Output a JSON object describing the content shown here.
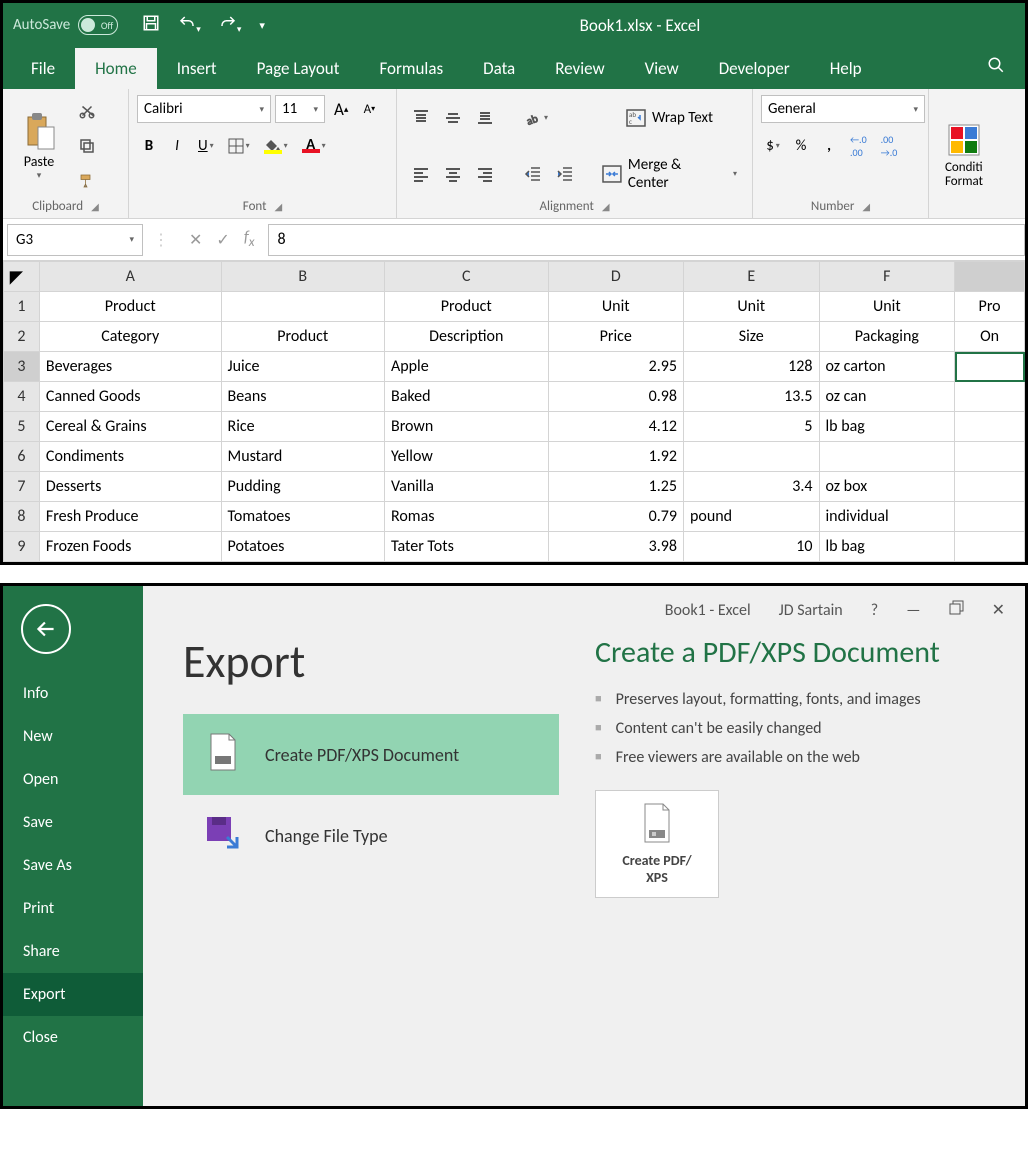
{
  "shot1": {
    "title": "Book1.xlsx  -  Excel",
    "autosave": "AutoSave",
    "autosave_state": "Off",
    "tabs": [
      "File",
      "Home",
      "Insert",
      "Page Layout",
      "Formulas",
      "Data",
      "Review",
      "View",
      "Developer",
      "Help"
    ],
    "active_tab": "Home",
    "ribbon": {
      "clipboard": {
        "label": "Clipboard",
        "paste": "Paste"
      },
      "font": {
        "label": "Font",
        "name": "Calibri",
        "size": "11"
      },
      "alignment": {
        "label": "Alignment",
        "wrap": "Wrap Text",
        "merge": "Merge & Center"
      },
      "number": {
        "label": "Number",
        "format": "General"
      },
      "cond": "Conditional Formatting"
    },
    "namebox": "G3",
    "formula": "8",
    "columns": [
      "A",
      "B",
      "C",
      "D",
      "E",
      "F",
      ""
    ],
    "header_rows": [
      [
        "Product",
        "",
        "Product",
        "Unit",
        "Unit",
        "Unit",
        "Pro"
      ],
      [
        "Category",
        "Product",
        "Description",
        "Price",
        "Size",
        "Packaging",
        "On"
      ]
    ],
    "rows": [
      {
        "n": 3,
        "c": [
          "Beverages",
          "Juice",
          "Apple",
          "2.95",
          "128",
          "oz carton",
          ""
        ]
      },
      {
        "n": 4,
        "c": [
          "Canned Goods",
          "Beans",
          "Baked",
          "0.98",
          "13.5",
          "oz can",
          ""
        ]
      },
      {
        "n": 5,
        "c": [
          "Cereal & Grains",
          "Rice",
          "Brown",
          "4.12",
          "5",
          "lb bag",
          ""
        ]
      },
      {
        "n": 6,
        "c": [
          "Condiments",
          "Mustard",
          "Yellow",
          "1.92",
          "",
          "",
          ""
        ]
      },
      {
        "n": 7,
        "c": [
          "Desserts",
          "Pudding",
          "Vanilla",
          "1.25",
          "3.4",
          "oz box",
          ""
        ]
      },
      {
        "n": 8,
        "c": [
          "Fresh Produce",
          "Tomatoes",
          "Romas",
          "0.79",
          "pound",
          "individual",
          ""
        ]
      },
      {
        "n": 9,
        "c": [
          "Frozen Foods",
          "Potatoes",
          "Tater Tots",
          "3.98",
          "10",
          "lb bag",
          ""
        ]
      }
    ]
  },
  "shot2": {
    "top": {
      "doc": "Book1  -  Excel",
      "user": "JD Sartain",
      "help": "?"
    },
    "side": [
      "Info",
      "New",
      "Open",
      "Save",
      "Save As",
      "Print",
      "Share",
      "Export",
      "Close"
    ],
    "active_side": "Export",
    "title": "Export",
    "options": [
      {
        "label": "Create PDF/XPS Document",
        "sel": true
      },
      {
        "label": "Change File Type",
        "sel": false
      }
    ],
    "detail": {
      "heading": "Create a PDF/XPS Document",
      "bullets": [
        "Preserves layout, formatting, fonts, and images",
        "Content can't be easily changed",
        "Free viewers are available on the web"
      ],
      "button": "Create PDF/\nXPS"
    }
  }
}
